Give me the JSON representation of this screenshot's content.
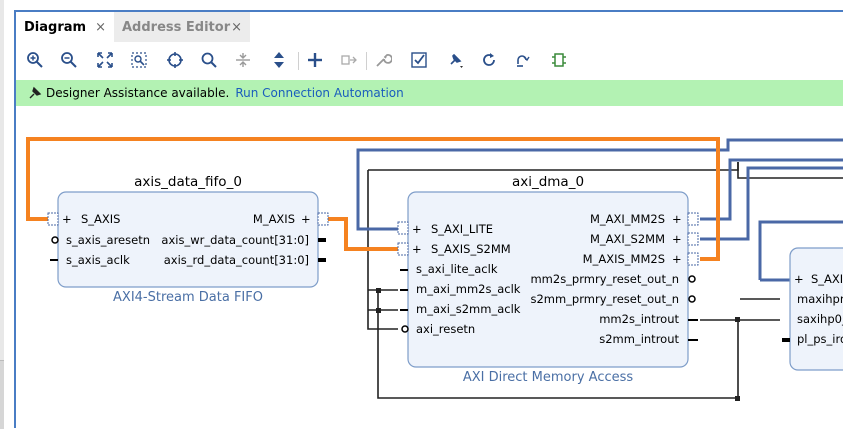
{
  "tabs": [
    {
      "label": "Diagram",
      "close": "×"
    },
    {
      "label": "Address Editor",
      "close": "×"
    }
  ],
  "toolbar": {
    "icons": [
      "zoom-in",
      "zoom-out",
      "zoom-fit",
      "zoom-area",
      "center",
      "search",
      "collapse-all",
      "expand-all",
      "add-ip",
      "create-port",
      "properties",
      "validate",
      "pin",
      "refresh",
      "regenerate",
      "ports"
    ]
  },
  "banner": {
    "message": "Designer Assistance available.",
    "link": "Run Connection Automation",
    "color": "#b3f2b3"
  },
  "blocks": {
    "fifo": {
      "name": "axis_data_fifo_0",
      "subtitle": "AXI4-Stream Data FIFO",
      "in_ports": [
        "S_AXIS",
        "s_axis_aresetn",
        "s_axis_aclk"
      ],
      "out_ports": [
        "M_AXIS",
        "axis_wr_data_count[31:0]",
        "axis_rd_data_count[31:0]"
      ]
    },
    "dma": {
      "name": "axi_dma_0",
      "subtitle": "AXI Direct Memory Access",
      "in_ports": [
        "S_AXI_LITE",
        "S_AXIS_S2MM",
        "s_axi_lite_aclk",
        "m_axi_mm2s_aclk",
        "m_axi_s2mm_aclk",
        "axi_resetn"
      ],
      "out_ports": [
        "M_AXI_MM2S",
        "M_AXI_S2MM",
        "M_AXIS_MM2S",
        "mm2s_prmry_reset_out_n",
        "s2mm_prmry_reset_out_n",
        "mm2s_introut",
        "s2mm_introut"
      ]
    },
    "ps": {
      "in_ports": [
        "S_AXI",
        "maxihpm",
        "saxihp0_",
        "pl_ps_irq"
      ]
    }
  },
  "colors": {
    "accent": "#4a7dc4",
    "stream_wire": "#f58220",
    "bus_wire": "#4a68a6",
    "block_fill": "#eef3fb",
    "block_border": "#7e9dc9"
  }
}
